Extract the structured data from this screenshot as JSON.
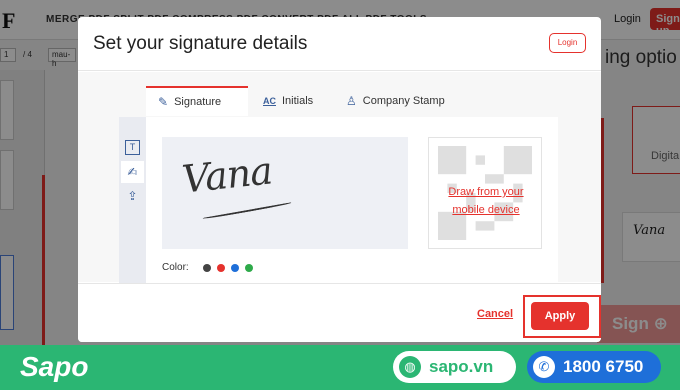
{
  "background": {
    "logo": "F",
    "menu": "MERGE PDF     SPLIT PDF     COMPRESS PDF     CONVERT PDF     ALL PDF TOOLS",
    "login": "Login",
    "signup": "Sign up",
    "page_input": "1",
    "page_total": "/ 4",
    "file_name": "mau-h",
    "right_title": "ing optio",
    "digital_label": "Digita",
    "mini_signature": "Vana",
    "sign_button": "Sign"
  },
  "modal": {
    "title": "Set your signature details",
    "login_chip": "Login",
    "tabs": [
      {
        "label": "Signature",
        "icon": "pen-icon",
        "glyph": "✎"
      },
      {
        "label": "Initials",
        "icon": "initials-icon",
        "glyph": "AC"
      },
      {
        "label": "Company Stamp",
        "icon": "stamp-icon",
        "glyph": "♙"
      }
    ],
    "tools": [
      {
        "name": "text-tool-icon",
        "glyph": "T"
      },
      {
        "name": "draw-tool-icon",
        "glyph": "✍"
      },
      {
        "name": "upload-tool-icon",
        "glyph": "⇪"
      }
    ],
    "signature_text": "Vana",
    "qr_link": "Draw from your mobile device",
    "color_label": "Color:",
    "colors": [
      "#444444",
      "#e5322d",
      "#1e6fd9",
      "#2eaa4a"
    ],
    "cancel": "Cancel",
    "apply": "Apply"
  },
  "banner": {
    "brand": "Sapo",
    "website": "sapo.vn",
    "phone": "1800 6750"
  }
}
